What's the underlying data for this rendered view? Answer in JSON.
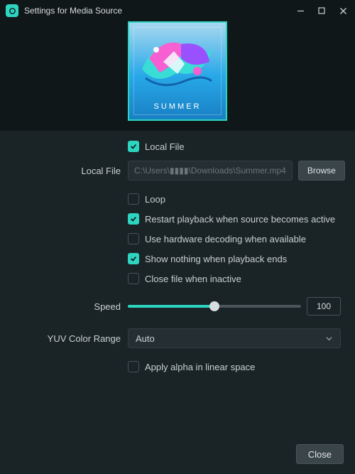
{
  "window": {
    "title": "Settings for Media Source",
    "minimize": "−",
    "maximize": "□",
    "close": "✕"
  },
  "preview": {
    "art_text": "SUMMER"
  },
  "form": {
    "local_file_check": "Local File",
    "local_file_label": "Local File",
    "local_file_path": "C:\\Users\\▮▮▮▮\\Downloads\\Summer.mp4",
    "browse": "Browse",
    "loop": "Loop",
    "restart": "Restart playback when source becomes active",
    "hwdecode": "Use hardware decoding when available",
    "show_nothing": "Show nothing when playback ends",
    "close_inactive": "Close file when inactive",
    "speed_label": "Speed",
    "speed_value": "100",
    "speed_percent": 50,
    "yuv_label": "YUV Color Range",
    "yuv_value": "Auto",
    "apply_alpha": "Apply alpha in linear space"
  },
  "footer": {
    "close": "Close"
  },
  "checks": {
    "local_file": true,
    "loop": false,
    "restart": true,
    "hwdecode": false,
    "show_nothing": true,
    "close_inactive": false,
    "apply_alpha": false
  }
}
